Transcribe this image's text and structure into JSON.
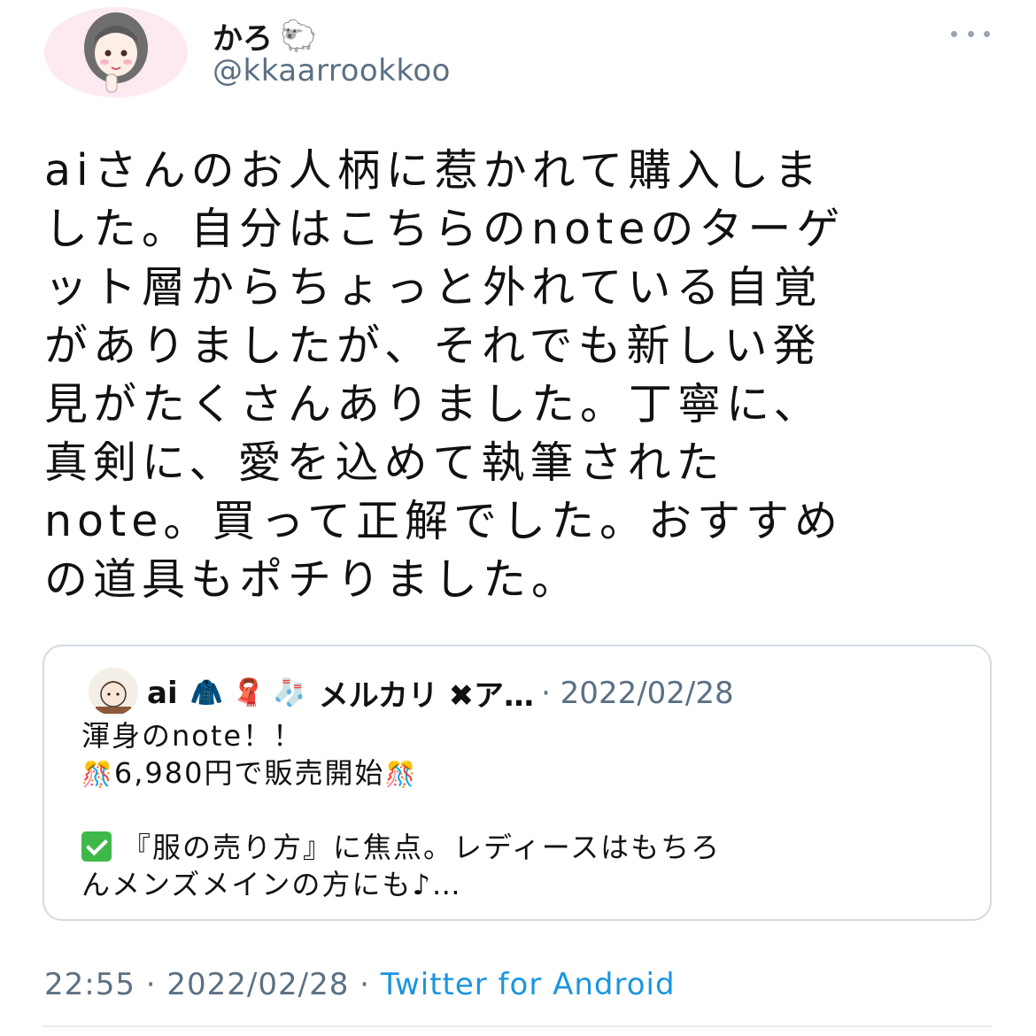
{
  "author": {
    "display_name": "かろ",
    "display_name_emoji": "🐑",
    "handle": "@kkaarrookkoo"
  },
  "tweet": {
    "lines": [
      "aiさんのお人柄に惹かれて購入しま",
      "した。自分はこちらのnoteのターゲ",
      "ット層からちょっと外れている自覚",
      "がありましたが、それでも新しい発",
      "見がたくさんありました。丁寧に、",
      "真剣に、愛を込めて執筆された",
      "note。買って正解でした。おすすめ",
      "の道具もポチりました。"
    ]
  },
  "quoted_tweet": {
    "name": "ai",
    "name_emojis": "🧥 🧣 🧦",
    "name_rest": "メルカリ ✖ア…",
    "date": "· 2022/02/28",
    "line1": "渾身のnote！！",
    "line2_emoji": "🎊",
    "line2_text": "6,980円で販売開始",
    "line4_text": "『服の売り方』に焦点。レディースはもちろ",
    "line5_text": "んメンズメインの方にも♪…"
  },
  "footer": {
    "time_date": "22:55 · 2022/02/28 · ",
    "source": "Twitter for Android"
  }
}
